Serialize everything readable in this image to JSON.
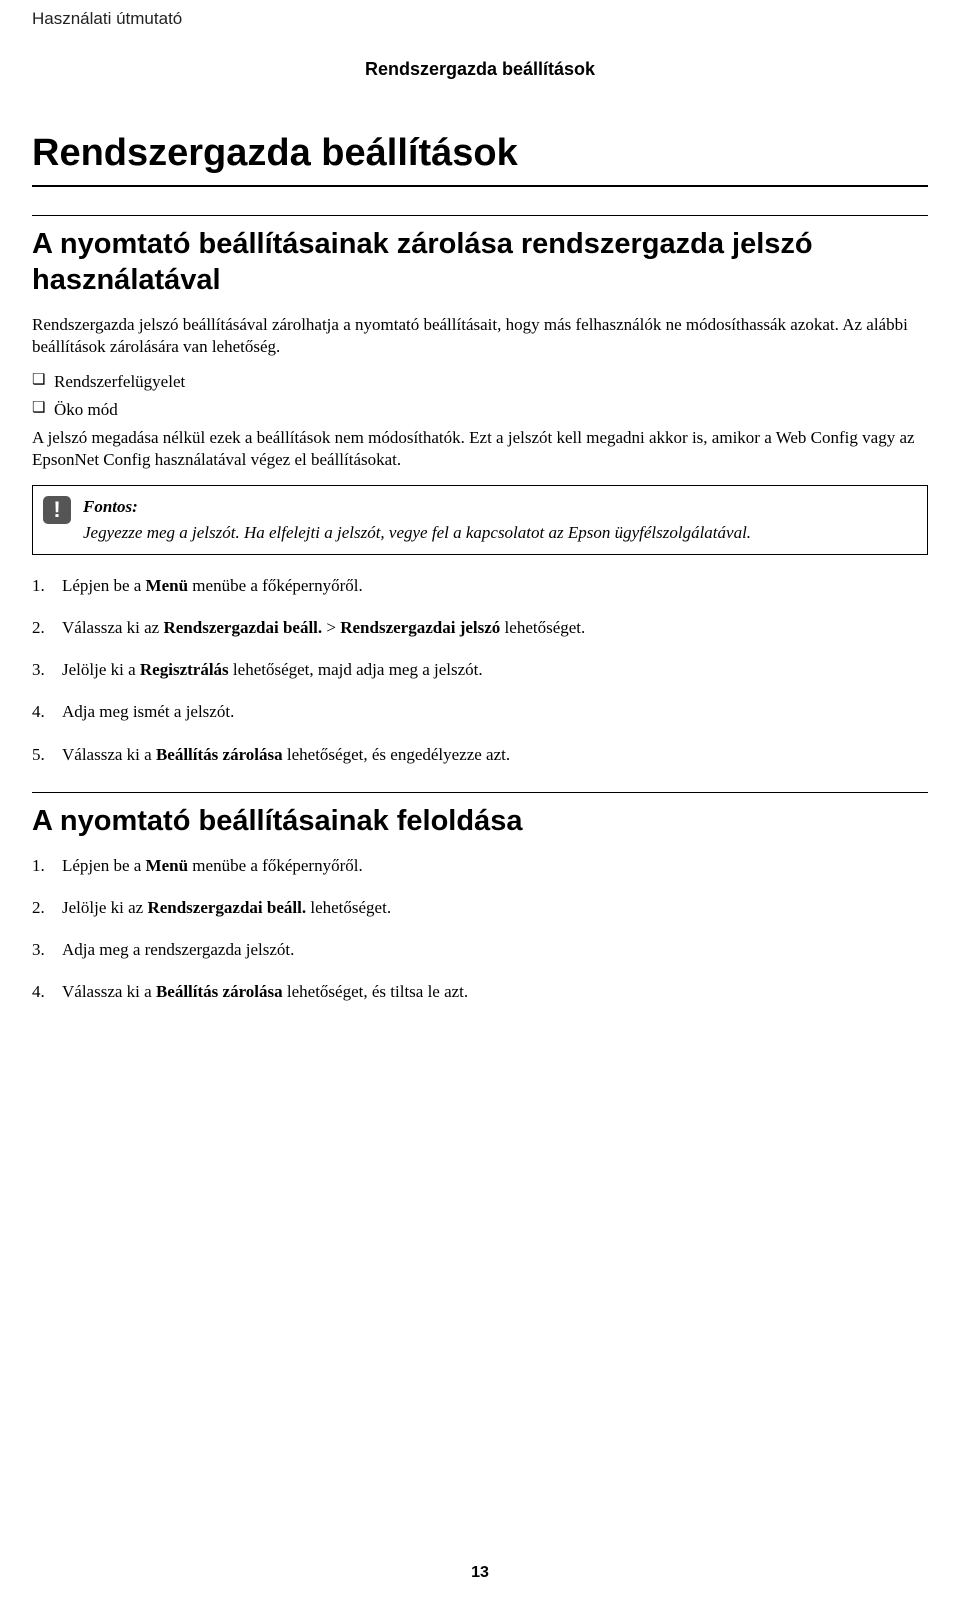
{
  "header": {
    "top": "Használati útmutató",
    "sub": "Rendszergazda beállítások"
  },
  "title": "Rendszergazda beállítások",
  "lock": {
    "heading": "A nyomtató beállításainak zárolása rendszergazda jelszó használatával",
    "intro": "Rendszergazda jelszó beállításával zárolhatja a nyomtató beállításait, hogy más felhasználók ne módosíthassák azokat. Az alábbi beállítások zárolására van lehetőség.",
    "bullets": [
      "Rendszerfelügyelet",
      "Öko mód"
    ],
    "para2": "A jelszó megadása nélkül ezek a beállítások nem módosíthatók. Ezt a jelszót kell megadni akkor is, amikor a Web Config vagy az EpsonNet Config használatával végez el beállításokat.",
    "important_label": "Fontos:",
    "important_body": "Jegyezze meg a jelszót. Ha elfelejti a jelszót, vegye fel a kapcsolatot az Epson ügyfélszolgálatával.",
    "steps": [
      {
        "pre": "Lépjen be a ",
        "b1": "Menü",
        "post": " menübe a főképernyőről."
      },
      {
        "pre": "Válassza ki az ",
        "b1": "Rendszergazdai beáll.",
        "mid": " > ",
        "b2": "Rendszergazdai jelszó",
        "post": " lehetőséget."
      },
      {
        "pre": "Jelölje ki a ",
        "b1": "Regisztrálás",
        "post": " lehetőséget, majd adja meg a jelszót."
      },
      {
        "pre": "Adja meg ismét a jelszót."
      },
      {
        "pre": "Válassza ki a ",
        "b1": "Beállítás zárolása",
        "post": " lehetőséget, és engedélyezze azt."
      }
    ]
  },
  "unlock": {
    "heading": "A nyomtató beállításainak feloldása",
    "steps": [
      {
        "pre": "Lépjen be a ",
        "b1": "Menü",
        "post": " menübe a főképernyőről."
      },
      {
        "pre": "Jelölje ki az ",
        "b1": "Rendszergazdai beáll.",
        "post": " lehetőséget."
      },
      {
        "pre": "Adja meg a rendszergazda jelszót."
      },
      {
        "pre": "Válassza ki a ",
        "b1": "Beállítás zárolása",
        "post": " lehetőséget, és tiltsa le azt."
      }
    ]
  },
  "page_number": "13"
}
